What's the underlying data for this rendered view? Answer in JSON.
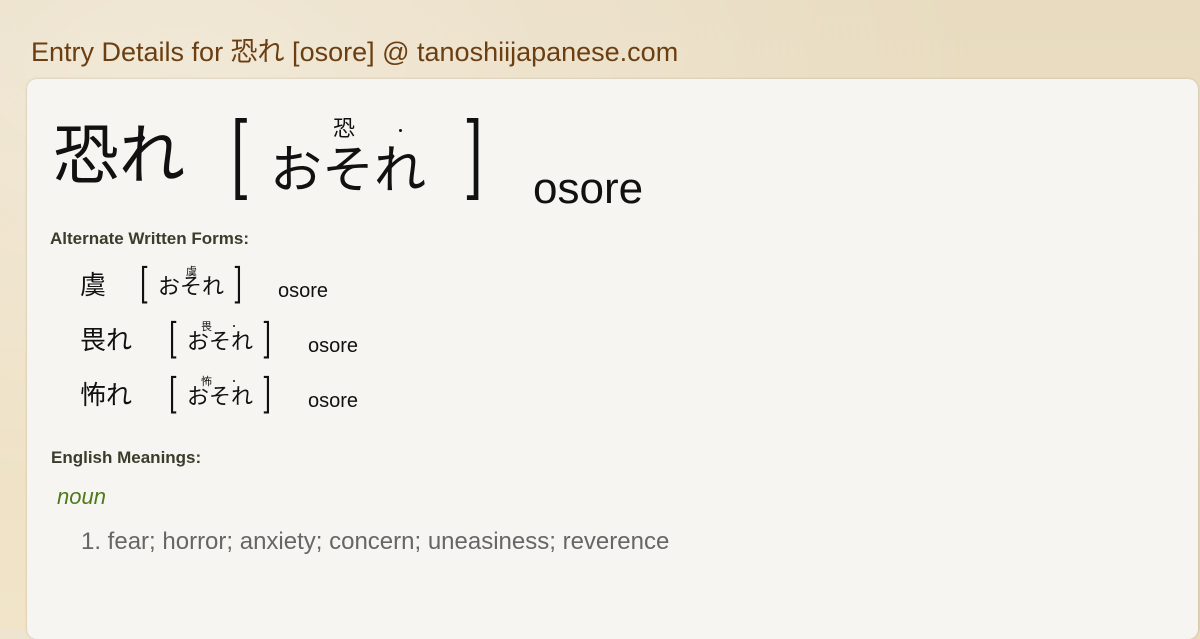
{
  "page": {
    "title": "Entry Details for 恐れ [osore] @ tanoshiijapanese.com"
  },
  "entry": {
    "kanji": "恐れ",
    "kana": "おそれ",
    "furigana": "恐",
    "romaji": "osore",
    "brackets": {
      "open": "[",
      "close": "]"
    }
  },
  "alternate": {
    "label": "Alternate Written Forms:",
    "forms": [
      {
        "kanji": "虞",
        "kana": "おそれ",
        "furigana": "虞",
        "romaji": "osore"
      },
      {
        "kanji": "畏れ",
        "kana": "おそれ",
        "furigana": "畏",
        "romaji": "osore"
      },
      {
        "kanji": "怖れ",
        "kana": "おそれ",
        "furigana": "怖",
        "romaji": "osore"
      }
    ]
  },
  "meanings": {
    "label": "English Meanings:",
    "part_of_speech": "noun",
    "items": [
      "1. fear; horror; anxiety; concern; uneasiness; reverence"
    ]
  },
  "colors": {
    "title": "#6b3f12",
    "part_of_speech": "#4d7a1a",
    "meaning_text": "#666666",
    "card_background": "#f7f5f1"
  }
}
